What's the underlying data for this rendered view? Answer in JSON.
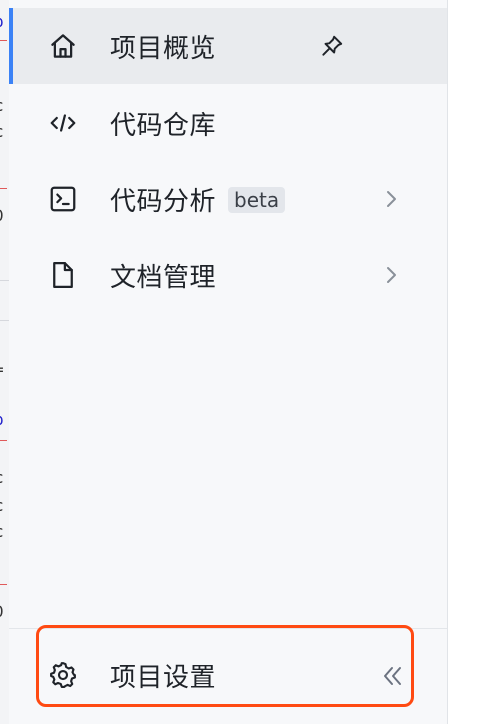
{
  "sidebar": {
    "items": [
      {
        "label": "项目概览",
        "icon": "home-icon",
        "active": true,
        "pinned": true
      },
      {
        "label": "代码仓库",
        "icon": "code-icon"
      },
      {
        "label": "代码分析",
        "icon": "terminal-icon",
        "badge": "beta",
        "expandable": true
      },
      {
        "label": "文档管理",
        "icon": "document-icon",
        "expandable": true
      }
    ],
    "footer": {
      "label": "项目设置",
      "icon": "gear-icon",
      "collapse_icon": "double-chevron-left-icon"
    }
  },
  "colors": {
    "active_indicator": "#3b82f6",
    "highlight_outline": "#ff4a12",
    "sidebar_bg": "#f7f8fa",
    "active_bg": "#e9ebee"
  }
}
